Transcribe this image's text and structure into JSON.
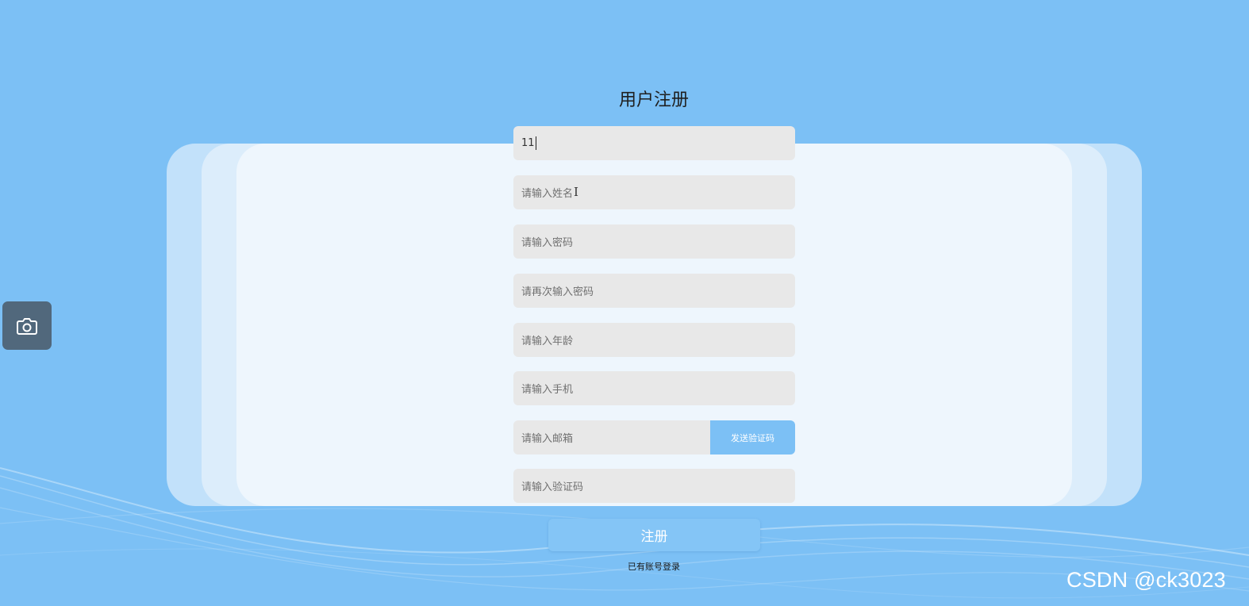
{
  "page": {
    "title": "用户注册"
  },
  "form": {
    "username": {
      "value": "11"
    },
    "name": {
      "placeholder": "请输入姓名"
    },
    "password": {
      "placeholder": "请输入密码"
    },
    "confirm_password": {
      "placeholder": "请再次输入密码"
    },
    "age": {
      "placeholder": "请输入年龄"
    },
    "phone": {
      "placeholder": "请输入手机"
    },
    "email": {
      "placeholder": "请输入邮箱"
    },
    "send_code_label": "发送验证码",
    "code": {
      "placeholder": "请输入验证码"
    },
    "submit_label": "注册",
    "login_link": "已有账号登录"
  },
  "side_tool": {
    "icon": "camera-icon"
  },
  "watermark": "CSDN @ck3023",
  "colors": {
    "background": "#7cc0f5",
    "accent": "#7cc0f5",
    "field_bg": "#e8e8e8"
  }
}
